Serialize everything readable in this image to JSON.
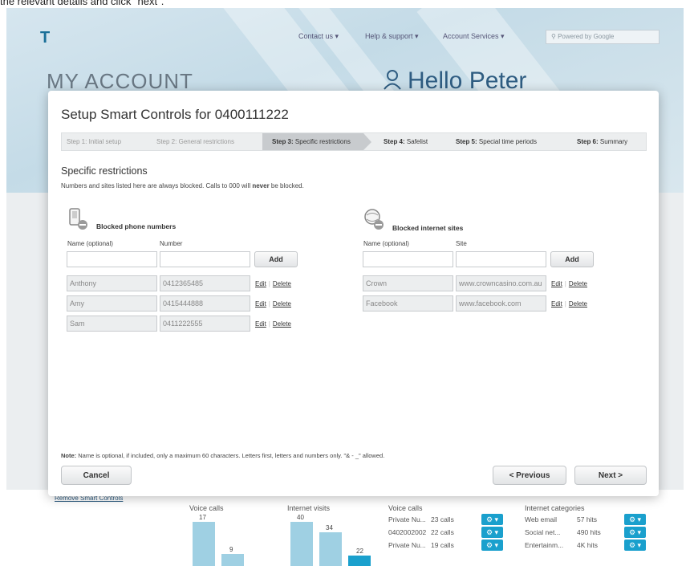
{
  "instruction": "the relevant details and click \"next\".",
  "background": {
    "nav": {
      "contact_us": "Contact us ▾",
      "help_support": "Help & support ▾",
      "account_services": "Account Services ▾",
      "search_placeholder": "Powered by Google"
    },
    "my_account": "MY ACCOUNT",
    "hello": "Hello Peter",
    "remove_link": "Remove Smart Controls",
    "voice_calls_label": "Voice calls",
    "internet_visits_label": "Internet visits",
    "voice_bars": [
      {
        "value": "17"
      },
      {
        "value": "9"
      }
    ],
    "internet_bars": [
      {
        "value": "40"
      },
      {
        "value": "34"
      },
      {
        "value": "22"
      }
    ],
    "voice_calls_table_label": "Voice calls",
    "internet_categories_label": "Internet categories",
    "voice_rows": [
      {
        "name": "Private Nu...",
        "count": "23 calls"
      },
      {
        "name": "0402002002",
        "count": "22 calls"
      },
      {
        "name": "Private Nu...",
        "count": "19 calls"
      }
    ],
    "category_rows": [
      {
        "name": "Web email",
        "count": "57 hits"
      },
      {
        "name": "Social net...",
        "count": "490 hits"
      },
      {
        "name": "Entertainm...",
        "count": "4K hits"
      }
    ],
    "accent_color": "#1aa0cd"
  },
  "modal": {
    "title": "Setup Smart Controls for 0400111222",
    "steps": [
      {
        "num": "Step 1:",
        "name": "Initial setup"
      },
      {
        "num": "Step 2:",
        "name": "General restrictions"
      },
      {
        "num": "Step 3:",
        "name": "Specific restrictions"
      },
      {
        "num": "Step 4:",
        "name": "Safelist"
      },
      {
        "num": "Step 5:",
        "name": "Special time periods"
      },
      {
        "num": "Step 6:",
        "name": "Summary"
      }
    ],
    "section_title": "Specific restrictions",
    "section_desc_pre": "Numbers and sites listed here are always blocked. Calls to 000 will ",
    "section_desc_bold": "never",
    "section_desc_post": " be blocked.",
    "phones": {
      "heading": "Blocked phone numbers",
      "name_label": "Name (optional)",
      "number_label": "Number",
      "name_value": "",
      "number_value": "",
      "add_label": "Add",
      "rows": [
        {
          "name": "Anthony",
          "number": "0412365485"
        },
        {
          "name": "Amy",
          "number": "0415444888"
        },
        {
          "name": "Sam",
          "number": "0411222555"
        }
      ]
    },
    "sites": {
      "heading": "Blocked internet sites",
      "name_label": "Name (optional)",
      "site_label": "Site",
      "name_value": "",
      "site_value": "",
      "add_label": "Add",
      "rows": [
        {
          "name": "Crown",
          "site": "www.crowncasino.com.au"
        },
        {
          "name": "Facebook",
          "site": "www.facebook.com"
        }
      ]
    },
    "edit_label": "Edit",
    "delete_label": "Delete",
    "note_label": "Note:",
    "note_text": " Name is optional, if included, only a maximum 60 characters. Letters first, letters and numbers only. \"& - _\" allowed.",
    "cancel_label": "Cancel",
    "previous_label": "< Previous",
    "next_label": "Next >"
  }
}
